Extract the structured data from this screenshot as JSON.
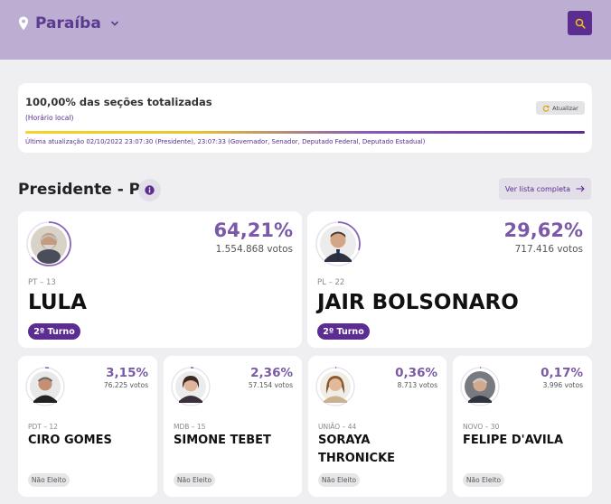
{
  "header": {
    "state": "Paraíba",
    "icons": {
      "location": "map-pin-icon",
      "dropdown": "chevron-down-icon",
      "search": "search-icon"
    },
    "colors": {
      "header_bg": "#bcadd3",
      "accent": "#5b2d91"
    }
  },
  "status": {
    "sections_text": "100,00% das seções totalizadas",
    "local_time": "(Horário local)",
    "refresh_label": "Atualizar",
    "progress_percent": 100,
    "last_update": "Última atualização 02/10/2022 23:07:30 (Presidente), 23:07:33 (Governador, Senador, Deputado Federal, Deputado Estadual)"
  },
  "section": {
    "title": "Presidente - PB",
    "full_list_label": "Ver lista completa"
  },
  "candidates": [
    {
      "percent": "64,21%",
      "votes": "1.554.868 votos",
      "party": "PT – 13",
      "name": "LULA",
      "badge": "2º Turno",
      "vote_fraction": 0.6421
    },
    {
      "percent": "29,62%",
      "votes": "717.416 votos",
      "party": "PL – 22",
      "name": "JAIR BOLSONARO",
      "badge": "2º Turno",
      "vote_fraction": 0.2962
    },
    {
      "percent": "3,15%",
      "votes": "76.225 votos",
      "party": "PDT – 12",
      "name": "CIRO GOMES",
      "badge": "Não Eleito",
      "vote_fraction": 0.0315
    },
    {
      "percent": "2,36%",
      "votes": "57.154 votos",
      "party": "MDB – 15",
      "name": "SIMONE TEBET",
      "badge": "Não Eleito",
      "vote_fraction": 0.0236
    },
    {
      "percent": "0,36%",
      "votes": "8.713 votos",
      "party": "UNIÃO – 44",
      "name": "SORAYA THRONICKE",
      "badge": "Não Eleito",
      "vote_fraction": 0.0036
    },
    {
      "percent": "0,17%",
      "votes": "3.996 votos",
      "party": "NOVO – 30",
      "name": "FELIPE D'AVILA",
      "badge": "Não Eleito",
      "vote_fraction": 0.0017
    }
  ]
}
